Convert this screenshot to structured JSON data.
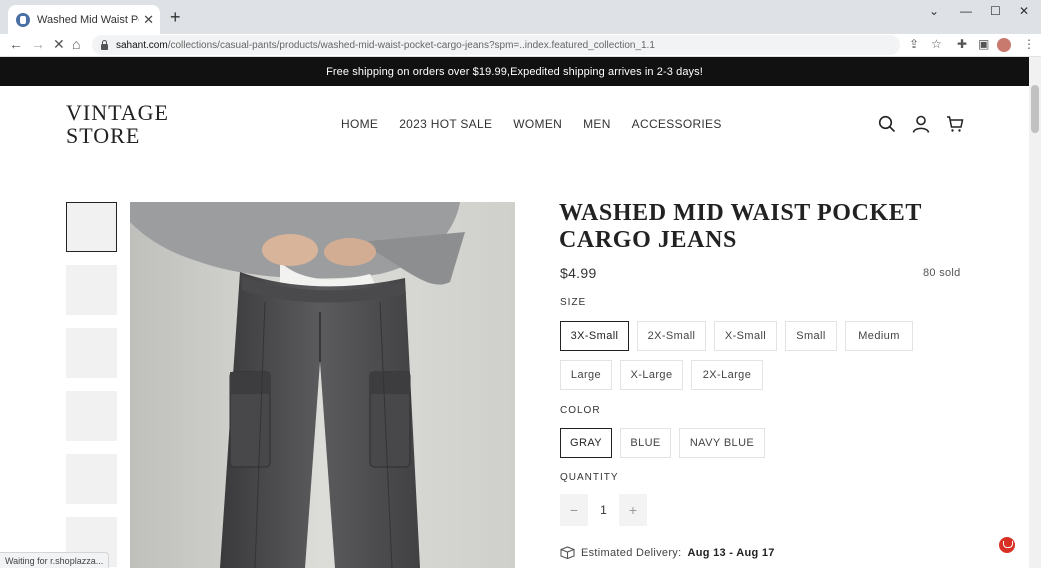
{
  "browser": {
    "tab_title": "Washed Mid Waist Pocket Cargo",
    "url_host": "sahant.com",
    "url_path": "/collections/casual-pants/products/washed-mid-waist-pocket-cargo-jeans?spm=..index.featured_collection_1.1",
    "status_text": "Waiting for r.shoplazza..."
  },
  "promo": {
    "text": "Free shipping on orders over $19.99,Expedited shipping arrives in 2-3 days!"
  },
  "header": {
    "logo_line1": "VINTAGE",
    "logo_line2": "STORE",
    "nav": [
      "HOME",
      "2023 HOT SALE",
      "WOMEN",
      "MEN",
      "ACCESSORIES"
    ]
  },
  "product": {
    "title": "WASHED MID WAIST POCKET CARGO JEANS",
    "price": "$4.99",
    "sold": "80 sold",
    "size_label": "SIZE",
    "sizes": [
      "3X-Small",
      "2X-Small",
      "X-Small",
      "Small",
      "Medium",
      "Large",
      "X-Large",
      "2X-Large"
    ],
    "selected_size": "3X-Small",
    "color_label": "COLOR",
    "colors": [
      "GRAY",
      "BLUE",
      "NAVY BLUE"
    ],
    "selected_color": "GRAY",
    "quantity_label": "QUANTITY",
    "quantity": "1",
    "qty_minus": "−",
    "qty_plus": "+",
    "delivery_label": "Estimated Delivery:",
    "delivery_dates": "Aug 13 - Aug 17"
  },
  "icons": {
    "search": "search-icon",
    "account": "account-icon",
    "cart": "cart-icon",
    "delivery": "package-icon",
    "chat": "chat-icon"
  },
  "colors": {
    "promo_bg": "#111111",
    "selected_border": "#222222",
    "chat_accent": "#d93025"
  }
}
